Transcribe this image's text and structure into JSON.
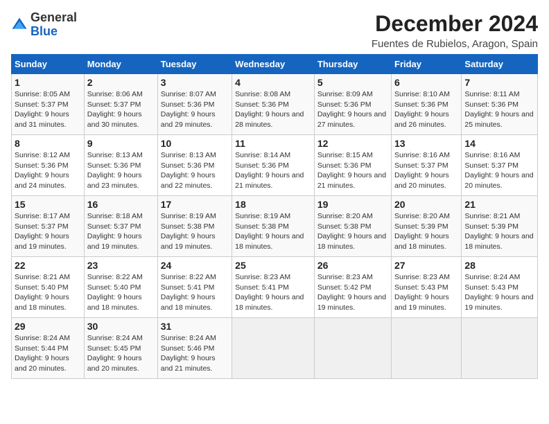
{
  "header": {
    "logo_general": "General",
    "logo_blue": "Blue",
    "title": "December 2024",
    "location": "Fuentes de Rubielos, Aragon, Spain"
  },
  "calendar": {
    "days_of_week": [
      "Sunday",
      "Monday",
      "Tuesday",
      "Wednesday",
      "Thursday",
      "Friday",
      "Saturday"
    ],
    "weeks": [
      [
        null,
        null,
        null,
        null,
        null,
        null,
        null
      ],
      [
        {
          "day": "1",
          "sunrise": "8:05 AM",
          "sunset": "5:37 PM",
          "daylight": "9 hours and 31 minutes."
        },
        {
          "day": "2",
          "sunrise": "8:06 AM",
          "sunset": "5:37 PM",
          "daylight": "9 hours and 30 minutes."
        },
        {
          "day": "3",
          "sunrise": "8:07 AM",
          "sunset": "5:36 PM",
          "daylight": "9 hours and 29 minutes."
        },
        {
          "day": "4",
          "sunrise": "8:08 AM",
          "sunset": "5:36 PM",
          "daylight": "9 hours and 28 minutes."
        },
        {
          "day": "5",
          "sunrise": "8:09 AM",
          "sunset": "5:36 PM",
          "daylight": "9 hours and 27 minutes."
        },
        {
          "day": "6",
          "sunrise": "8:10 AM",
          "sunset": "5:36 PM",
          "daylight": "9 hours and 26 minutes."
        },
        {
          "day": "7",
          "sunrise": "8:11 AM",
          "sunset": "5:36 PM",
          "daylight": "9 hours and 25 minutes."
        }
      ],
      [
        {
          "day": "8",
          "sunrise": "8:12 AM",
          "sunset": "5:36 PM",
          "daylight": "9 hours and 24 minutes."
        },
        {
          "day": "9",
          "sunrise": "8:13 AM",
          "sunset": "5:36 PM",
          "daylight": "9 hours and 23 minutes."
        },
        {
          "day": "10",
          "sunrise": "8:13 AM",
          "sunset": "5:36 PM",
          "daylight": "9 hours and 22 minutes."
        },
        {
          "day": "11",
          "sunrise": "8:14 AM",
          "sunset": "5:36 PM",
          "daylight": "9 hours and 21 minutes."
        },
        {
          "day": "12",
          "sunrise": "8:15 AM",
          "sunset": "5:36 PM",
          "daylight": "9 hours and 21 minutes."
        },
        {
          "day": "13",
          "sunrise": "8:16 AM",
          "sunset": "5:37 PM",
          "daylight": "9 hours and 20 minutes."
        },
        {
          "day": "14",
          "sunrise": "8:16 AM",
          "sunset": "5:37 PM",
          "daylight": "9 hours and 20 minutes."
        }
      ],
      [
        {
          "day": "15",
          "sunrise": "8:17 AM",
          "sunset": "5:37 PM",
          "daylight": "9 hours and 19 minutes."
        },
        {
          "day": "16",
          "sunrise": "8:18 AM",
          "sunset": "5:37 PM",
          "daylight": "9 hours and 19 minutes."
        },
        {
          "day": "17",
          "sunrise": "8:19 AM",
          "sunset": "5:38 PM",
          "daylight": "9 hours and 19 minutes."
        },
        {
          "day": "18",
          "sunrise": "8:19 AM",
          "sunset": "5:38 PM",
          "daylight": "9 hours and 18 minutes."
        },
        {
          "day": "19",
          "sunrise": "8:20 AM",
          "sunset": "5:38 PM",
          "daylight": "9 hours and 18 minutes."
        },
        {
          "day": "20",
          "sunrise": "8:20 AM",
          "sunset": "5:39 PM",
          "daylight": "9 hours and 18 minutes."
        },
        {
          "day": "21",
          "sunrise": "8:21 AM",
          "sunset": "5:39 PM",
          "daylight": "9 hours and 18 minutes."
        }
      ],
      [
        {
          "day": "22",
          "sunrise": "8:21 AM",
          "sunset": "5:40 PM",
          "daylight": "9 hours and 18 minutes."
        },
        {
          "day": "23",
          "sunrise": "8:22 AM",
          "sunset": "5:40 PM",
          "daylight": "9 hours and 18 minutes."
        },
        {
          "day": "24",
          "sunrise": "8:22 AM",
          "sunset": "5:41 PM",
          "daylight": "9 hours and 18 minutes."
        },
        {
          "day": "25",
          "sunrise": "8:23 AM",
          "sunset": "5:41 PM",
          "daylight": "9 hours and 18 minutes."
        },
        {
          "day": "26",
          "sunrise": "8:23 AM",
          "sunset": "5:42 PM",
          "daylight": "9 hours and 19 minutes."
        },
        {
          "day": "27",
          "sunrise": "8:23 AM",
          "sunset": "5:43 PM",
          "daylight": "9 hours and 19 minutes."
        },
        {
          "day": "28",
          "sunrise": "8:24 AM",
          "sunset": "5:43 PM",
          "daylight": "9 hours and 19 minutes."
        }
      ],
      [
        {
          "day": "29",
          "sunrise": "8:24 AM",
          "sunset": "5:44 PM",
          "daylight": "9 hours and 20 minutes."
        },
        {
          "day": "30",
          "sunrise": "8:24 AM",
          "sunset": "5:45 PM",
          "daylight": "9 hours and 20 minutes."
        },
        {
          "day": "31",
          "sunrise": "8:24 AM",
          "sunset": "5:46 PM",
          "daylight": "9 hours and 21 minutes."
        },
        null,
        null,
        null,
        null
      ]
    ]
  }
}
